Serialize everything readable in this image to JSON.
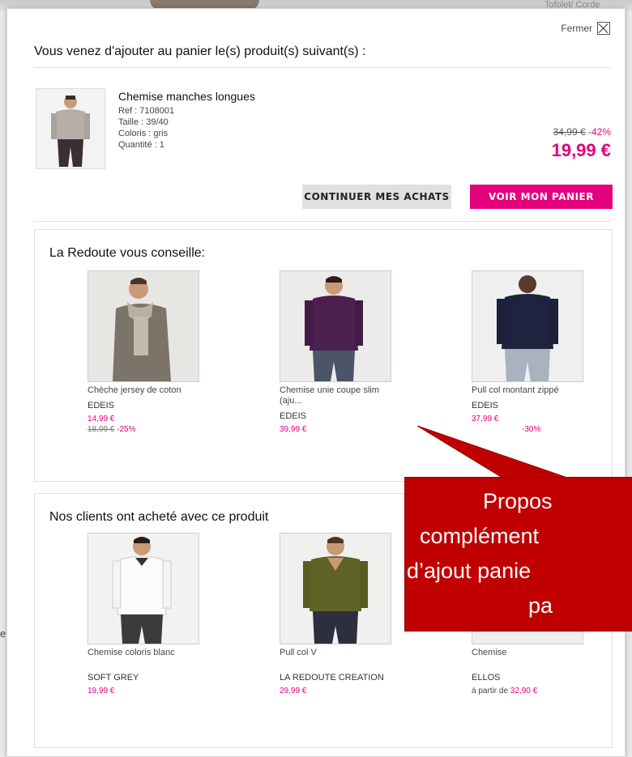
{
  "background": {
    "corner_text": "Tofolet/ Corde",
    "left_char": "e"
  },
  "modal": {
    "close_label": "Fermer",
    "title": "Vous venez d'ajouter au panier le(s) produit(s) suivant(s) :",
    "product": {
      "name": "Chemise manches longues",
      "ref": "Ref : 7108001",
      "size": "Taille : 39/40",
      "color": "Coloris : gris",
      "quantity": "Quantité : 1",
      "old_price": "34,99 €",
      "discount": "-42%",
      "price": "19,99 €"
    },
    "buttons": {
      "continue": "CONTINUER MES ACHATS",
      "cart": "VOIR MON PANIER"
    },
    "advice": {
      "title": "La Redoute vous conseille:",
      "items": [
        {
          "name": "Chèche jersey de coton",
          "brand": "EDEIS",
          "price": "14,99 €",
          "old_price": "18,99 €",
          "discount": "-25%"
        },
        {
          "name": "Chemise unie coupe slim (aju...",
          "brand": "EDEIS",
          "price": "39,99 €",
          "old_price": "",
          "discount": ""
        },
        {
          "name": "Pull col montant zippé",
          "brand": "EDEIS",
          "price": "37,99 €",
          "old_price": "",
          "discount": "-30%"
        }
      ]
    },
    "bought": {
      "title": "Nos clients ont acheté avec ce produit",
      "items": [
        {
          "name": "Chemise coloris blanc",
          "brand": "SOFT GREY",
          "price": "19,99 €",
          "price_prefix": ""
        },
        {
          "name": "Pull col V",
          "brand": "LA REDOUTE CREATION",
          "price": "29,99 €",
          "price_prefix": ""
        },
        {
          "name": "Chemise",
          "brand": "ELLOS",
          "price": "32,90 €",
          "price_prefix": "à partir de"
        }
      ]
    }
  },
  "callout": {
    "line1": "Propos",
    "line2": "complément",
    "line3": "d’ajout panie",
    "line4": "pa"
  },
  "colors": {
    "accent": "#e4007c",
    "callout": "#c00000"
  }
}
